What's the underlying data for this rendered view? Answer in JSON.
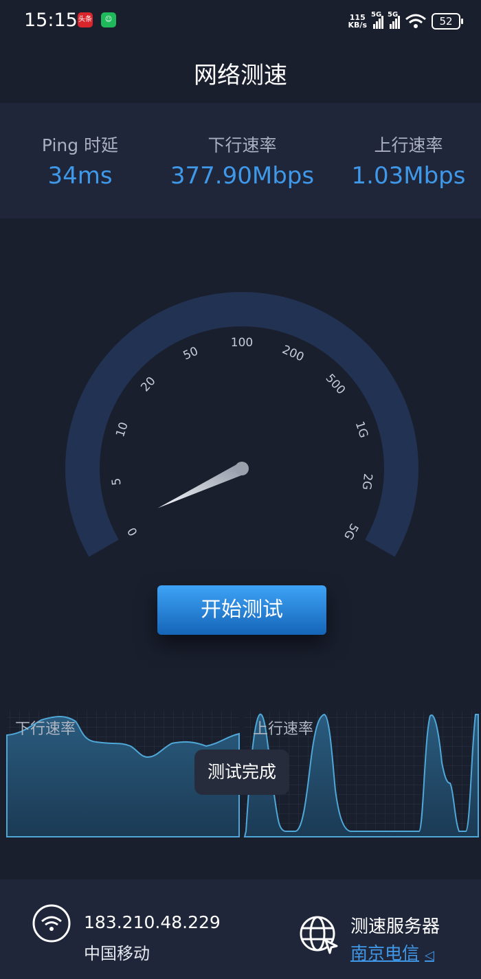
{
  "status_bar": {
    "time": "15:15",
    "app1_label": "头条",
    "app2_label": "☺",
    "net_speed_value": "115",
    "net_speed_unit": "KB/s",
    "sim1_tag": "5G",
    "sim2_tag": "5G",
    "battery": "52"
  },
  "title": "网络测速",
  "stats": {
    "ping_label": "Ping 时延",
    "ping_value": "34ms",
    "down_label": "下行速率",
    "down_value": "377.90Mbps",
    "up_label": "上行速率",
    "up_value": "1.03Mbps"
  },
  "gauge": {
    "ticks": [
      "0",
      "5",
      "10",
      "20",
      "50",
      "100",
      "200",
      "500",
      "1G",
      "2G",
      "5G"
    ],
    "needle_fraction": 0.02
  },
  "start_button": "开始测试",
  "charts": {
    "down_label": "下行速率",
    "up_label": "上行速率",
    "toast": "测试完成"
  },
  "footer": {
    "ip": "183.210.48.229",
    "carrier": "中国移动",
    "server_label": "测速服务器",
    "server_name": "南京电信"
  },
  "colors": {
    "accent": "#3f98e8",
    "background": "#1a1f2e",
    "panel": "#20263a",
    "gauge_track": "#223253"
  }
}
